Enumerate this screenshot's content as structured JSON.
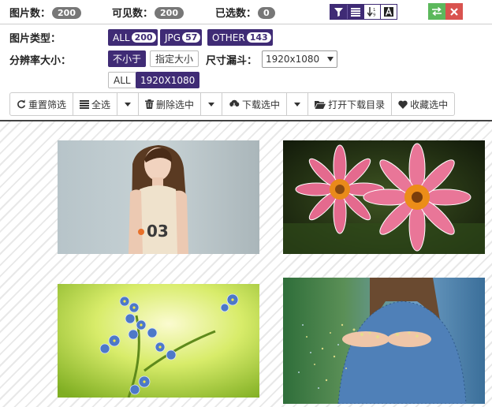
{
  "stats": {
    "total_label": "图片数：",
    "total_value": "200",
    "visible_label": "可见数：",
    "visible_value": "200",
    "selected_label": "已选数：",
    "selected_value": "0"
  },
  "toolbar": {
    "filter_icon": "filter-icon",
    "list_icon": "list-icon",
    "sort_icon": "sort-numeric-icon",
    "font_icon": "font-icon",
    "swap_icon": "swap-icon",
    "close_icon": "close-icon",
    "accent": "#3f2b75",
    "green": "#5cb85c",
    "red": "#d9534f"
  },
  "filters": {
    "type_label": "图片类型：",
    "types": [
      {
        "label": "ALL",
        "count": "200"
      },
      {
        "label": "JPG",
        "count": "57"
      },
      {
        "label": "OTHER",
        "count": "143"
      }
    ],
    "resolution_label": "分辨率大小：",
    "resolution_modes": [
      "不小于",
      "指定大小"
    ],
    "funnel_label": "尺寸漏斗：",
    "funnel_value": "1920x1080",
    "sizes": [
      "ALL",
      "1920X1080"
    ]
  },
  "actions": {
    "reset": "重置筛选",
    "select_all": "全选",
    "delete_selected": "删除选中",
    "download_selected": "下载选中",
    "open_dir": "打开下载目录",
    "favorite_selected": "收藏选中"
  },
  "gallery": {
    "images": [
      {
        "name": "girl-tank-top-photo",
        "colors": [
          "#c4cfd2",
          "#a9b8bd"
        ]
      },
      {
        "name": "pink-flowers-photo",
        "colors": [
          "#1c2a12",
          "#3d4f22"
        ]
      },
      {
        "name": "blue-flowers-photo",
        "colors": [
          "#e9f28c",
          "#a2cc3c"
        ]
      },
      {
        "name": "girl-glitter-photo",
        "colors": [
          "#3b7a43",
          "#5c8fb8"
        ]
      }
    ]
  }
}
